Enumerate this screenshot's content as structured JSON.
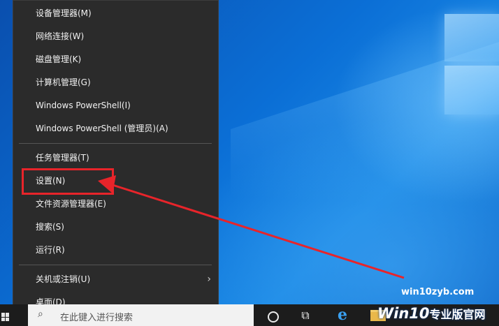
{
  "menu": {
    "items": [
      {
        "label": "设备管理器(M)"
      },
      {
        "label": "网络连接(W)"
      },
      {
        "label": "磁盘管理(K)"
      },
      {
        "label": "计算机管理(G)"
      },
      {
        "label": "Windows PowerShell(I)"
      },
      {
        "label": "Windows PowerShell (管理员)(A)"
      },
      {
        "label": "任务管理器(T)"
      },
      {
        "label": "设置(N)"
      },
      {
        "label": "文件资源管理器(E)"
      },
      {
        "label": "搜索(S)"
      },
      {
        "label": "运行(R)"
      },
      {
        "label": "关机或注销(U)"
      },
      {
        "label": "桌面(D)"
      }
    ],
    "submenu_chevron": "›"
  },
  "taskbar": {
    "search_placeholder": "在此键入进行搜索",
    "search_glyph": "⌕",
    "taskview_glyph": "⧉",
    "edge_glyph": "e"
  },
  "watermark": {
    "site": "win10zyb.com",
    "brand": "Win10",
    "brand_suffix": "专业版官网"
  },
  "colors": {
    "menu_bg": "#2b2b2b",
    "highlight_red": "#e8242a",
    "desktop_blue": "#0b6fd6"
  }
}
